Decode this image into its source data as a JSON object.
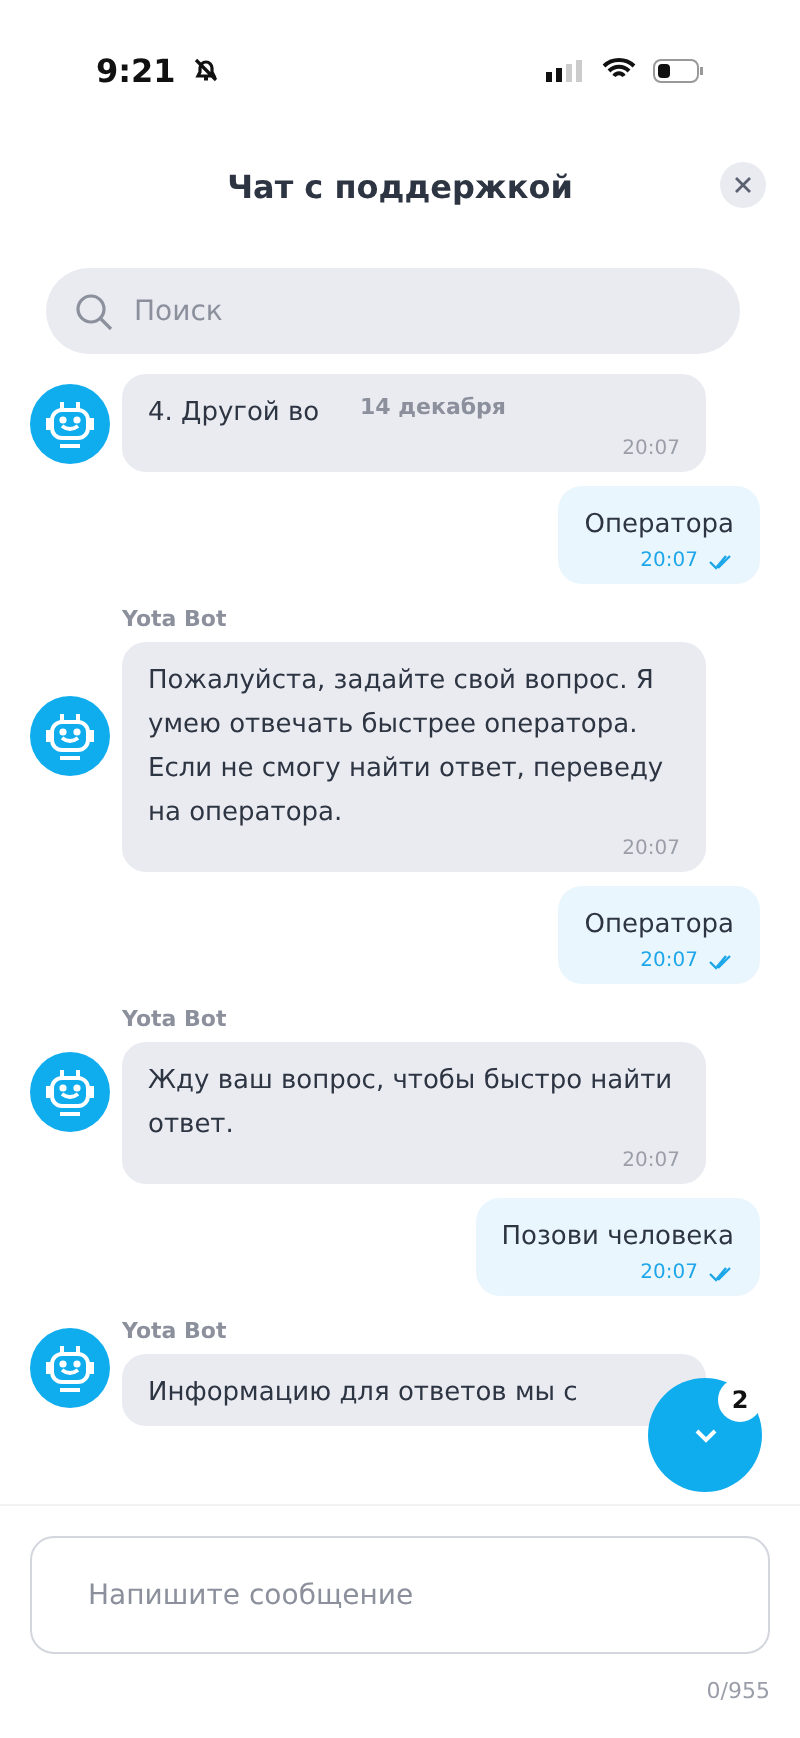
{
  "status_bar": {
    "time": "9:21"
  },
  "header": {
    "title": "Чат с поддержкой"
  },
  "search": {
    "placeholder": "Поиск"
  },
  "date_chip": "14 декабря",
  "messages": [
    {
      "kind": "bot",
      "text": "4. Другой во",
      "time": "20:07"
    },
    {
      "kind": "user",
      "text": "Оператора",
      "time": "20:07",
      "read": true
    },
    {
      "kind": "bot",
      "sender": "Yota Bot",
      "text": "Пожалуйста, задайте свой вопрос. Я умею отвечать быстрее оператора. Если не смогу найти ответ, переведу на оператора.",
      "time": "20:07"
    },
    {
      "kind": "user",
      "text": "Оператора",
      "time": "20:07",
      "read": true
    },
    {
      "kind": "bot",
      "sender": "Yota Bot",
      "text": "Жду ваш вопрос, чтобы быстро найти ответ.",
      "time": "20:07"
    },
    {
      "kind": "user",
      "text": "Позови человека",
      "time": "20:07",
      "read": true
    },
    {
      "kind": "bot",
      "sender": "Yota Bot",
      "text": "Информацию для ответов мы с"
    }
  ],
  "scroll_button": {
    "badge": "2"
  },
  "composer": {
    "placeholder": "Напишите сообщение",
    "counter": "0/955"
  }
}
